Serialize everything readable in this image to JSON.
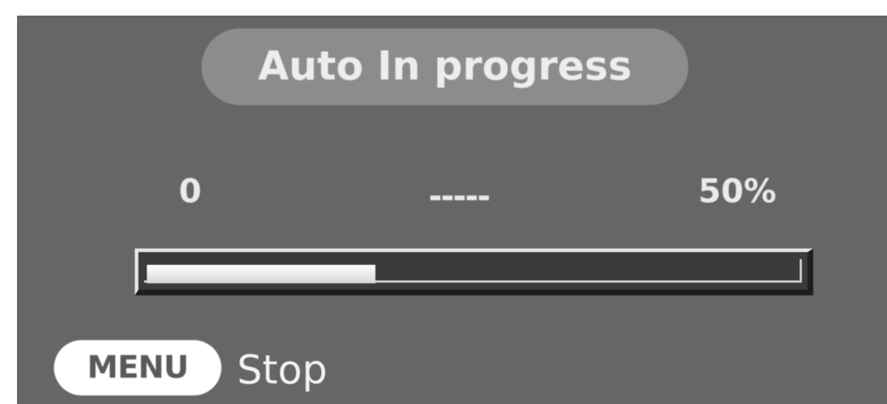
{
  "status": {
    "title": "Auto In progress"
  },
  "scale": {
    "min_label": "0",
    "mid_label": "-----",
    "max_label": "50%"
  },
  "progress": {
    "value_fraction": 0.35
  },
  "footer": {
    "menu_button_label": "MENU",
    "action_label": "Stop"
  },
  "colors": {
    "screen_background": "#666666",
    "pill_background": "#8c8c8c",
    "fill": "#ffffff"
  }
}
